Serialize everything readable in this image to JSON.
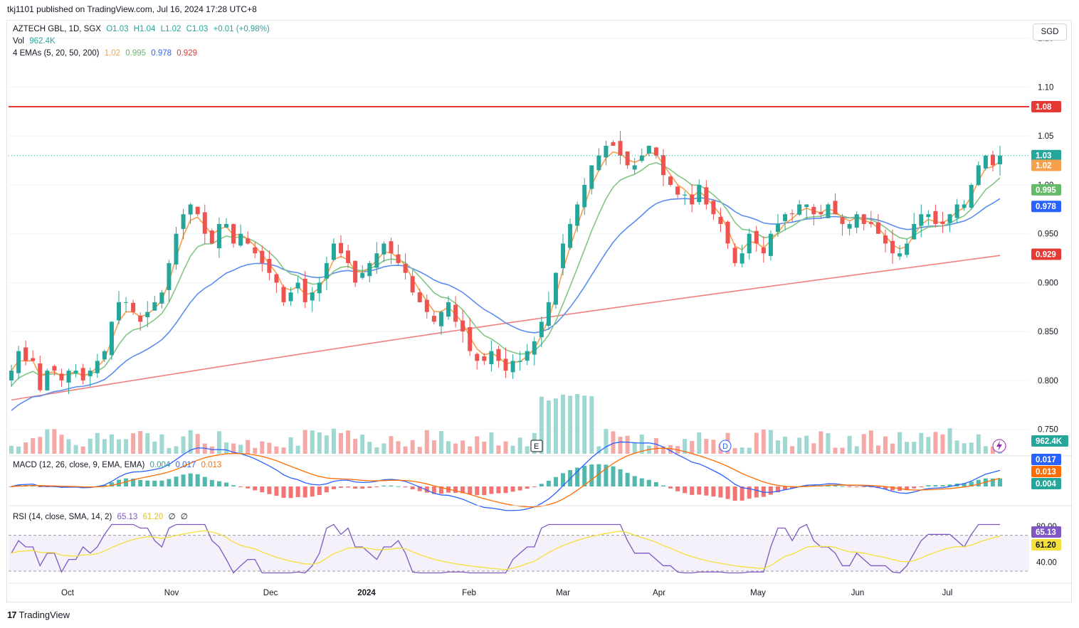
{
  "header": {
    "publisher": "tkj1101 published on TradingView.com, Jul 16, 2024 17:28 UTC+8"
  },
  "legend": {
    "symbol": "AZTECH GBL, 1D, SGX",
    "open": "O1.03",
    "high": "H1.04",
    "low": "L1.02",
    "close": "C1.03",
    "change": "+0.01 (+0.98%)",
    "vol_label": "Vol",
    "vol_value": "962.4K",
    "ema_label": "4 EMAs (5, 20, 50, 200)",
    "ema5": "1.02",
    "ema20": "0.995",
    "ema50": "0.978",
    "ema200": "0.929",
    "macd_label": "MACD (12, 26, close, 9, EMA, EMA)",
    "macd_hist": "0.004",
    "macd_line": "0.017",
    "macd_signal": "0.013",
    "rsi_label": "RSI (14, close, SMA, 14, 2)",
    "rsi_value": "65.13",
    "rsi_ma": "61.20",
    "rsi_z1": "∅",
    "rsi_z2": "∅"
  },
  "currency_button": "SGD",
  "footer": {
    "brand": "TradingView",
    "logo": "17"
  },
  "colors": {
    "up": "#26a69a",
    "down": "#ef5350",
    "ema5": "#f7a04b",
    "ema20": "#81c784",
    "ema50": "#5b8def",
    "ema200": "#f08080",
    "resistance": "#e53935",
    "macd": "#2962ff",
    "signal": "#ff6d00",
    "rsi": "#7e57c2",
    "rsi_ma": "#f4e03b"
  },
  "chart_data": {
    "type": "candlestick",
    "price_axis_ticks": [
      "1.15",
      "1.10",
      "1.05",
      "1.00",
      "0.950",
      "0.900",
      "0.850",
      "0.800",
      "0.750"
    ],
    "price_axis_range": [
      0.725,
      1.16
    ],
    "resistance_level": 1.08,
    "current_price": 1.03,
    "price_labels": [
      {
        "value": 1.08,
        "text": "1.08",
        "color": "#e53935"
      },
      {
        "value": 1.03,
        "text": "1.03",
        "color": "#26a69a"
      },
      {
        "value": 1.02,
        "text": "1.02",
        "color": "#f7a04b"
      },
      {
        "value": 0.995,
        "text": "0.995",
        "color": "#66bb6a"
      },
      {
        "value": 0.978,
        "text": "0.978",
        "color": "#2962ff"
      },
      {
        "value": 0.929,
        "text": "0.929",
        "color": "#e53935"
      }
    ],
    "volume_label": "962.4K",
    "x_axis_labels": [
      "Oct",
      "Nov",
      "Dec",
      "2024",
      "Feb",
      "Mar",
      "Apr",
      "May",
      "Jun",
      "Jul"
    ],
    "candles_close_approx": [
      0.81,
      0.83,
      0.82,
      0.82,
      0.79,
      0.81,
      0.81,
      0.8,
      0.81,
      0.81,
      0.8,
      0.81,
      0.82,
      0.83,
      0.86,
      0.88,
      0.88,
      0.87,
      0.86,
      0.87,
      0.88,
      0.89,
      0.92,
      0.95,
      0.97,
      0.98,
      0.97,
      0.95,
      0.94,
      0.96,
      0.96,
      0.94,
      0.95,
      0.94,
      0.93,
      0.92,
      0.91,
      0.9,
      0.88,
      0.89,
      0.9,
      0.88,
      0.89,
      0.9,
      0.92,
      0.94,
      0.93,
      0.92,
      0.9,
      0.91,
      0.92,
      0.93,
      0.94,
      0.93,
      0.92,
      0.91,
      0.89,
      0.88,
      0.87,
      0.86,
      0.87,
      0.88,
      0.86,
      0.85,
      0.83,
      0.82,
      0.82,
      0.83,
      0.82,
      0.81,
      0.82,
      0.82,
      0.83,
      0.84,
      0.86,
      0.88,
      0.91,
      0.94,
      0.96,
      0.98,
      1.0,
      1.02,
      1.03,
      1.04,
      1.04,
      1.03,
      1.02,
      1.02,
      1.03,
      1.04,
      1.03,
      1.01,
      1.0,
      0.99,
      0.99,
      0.98,
      1.0,
      0.98,
      0.97,
      0.96,
      0.94,
      0.92,
      0.93,
      0.95,
      0.94,
      0.93,
      0.95,
      0.96,
      0.97,
      0.97,
      0.98,
      0.98,
      0.97,
      0.97,
      0.98,
      0.97,
      0.96,
      0.96,
      0.97,
      0.96,
      0.96,
      0.95,
      0.94,
      0.93,
      0.93,
      0.94,
      0.96,
      0.97,
      0.97,
      0.96,
      0.96,
      0.97,
      0.98,
      0.98,
      1.0,
      1.02,
      1.03,
      1.02,
      1.03
    ],
    "rsi_axis_ticks": [
      "80.00",
      "40.00"
    ],
    "macd_values": {
      "macd": 0.017,
      "signal": 0.013,
      "histogram": 0.004
    },
    "rsi_values": {
      "rsi": 65.13,
      "rsi_ma": 61.2
    }
  }
}
